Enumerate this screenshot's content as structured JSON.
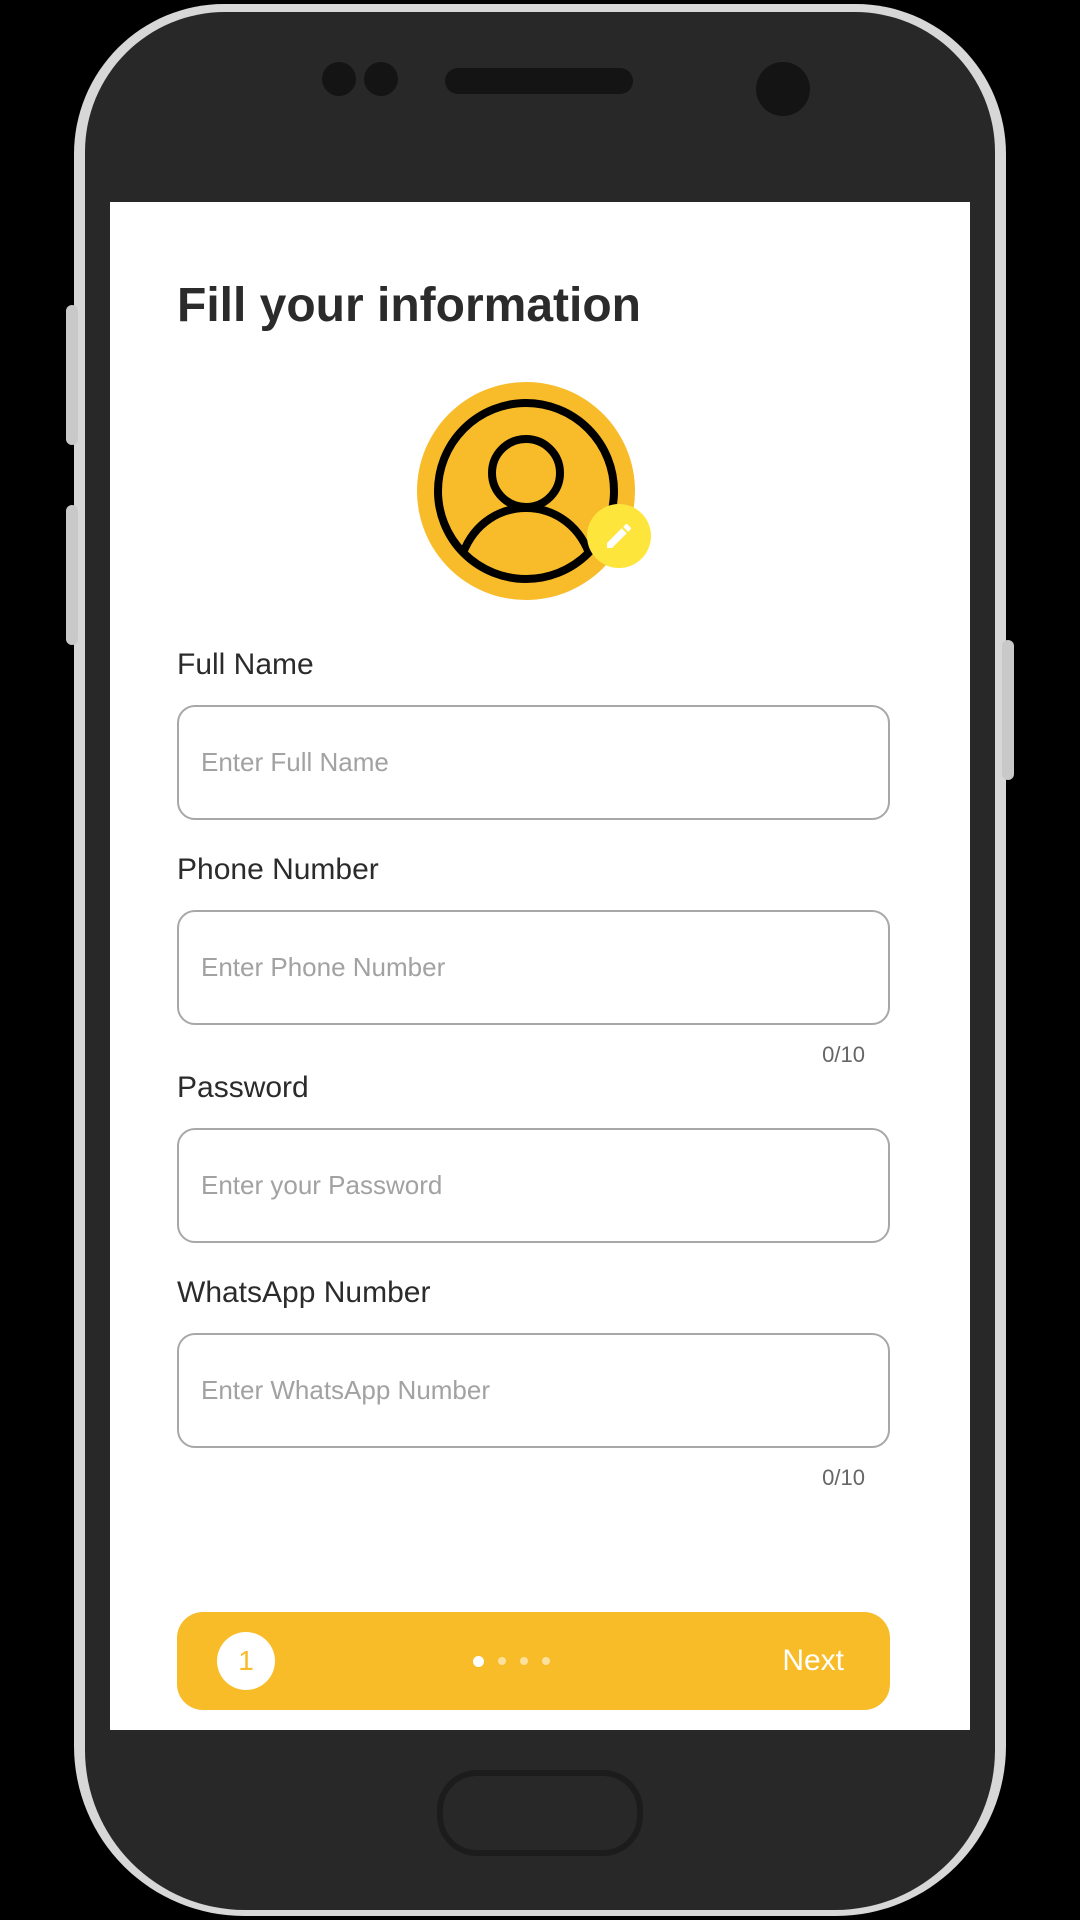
{
  "screen": {
    "title": "Fill your information"
  },
  "avatar": {
    "icon": "user-circle-icon",
    "edit_icon": "pencil-icon",
    "color": "#f8bc2b",
    "edit_color": "#fde53c"
  },
  "form": {
    "full_name": {
      "label": "Full Name",
      "placeholder": "Enter Full Name",
      "value": ""
    },
    "phone": {
      "label": "Phone Number",
      "placeholder": "Enter Phone Number",
      "value": "",
      "counter": "0/10"
    },
    "password": {
      "label": "Password",
      "placeholder": "Enter your Password",
      "value": ""
    },
    "whatsapp": {
      "label": "WhatsApp Number",
      "placeholder": "Enter WhatsApp Number",
      "value": "",
      "counter": "0/10"
    }
  },
  "footer": {
    "step": "1",
    "total_steps": 4,
    "current_step_index": 0,
    "next_label": "Next",
    "accent_color": "#f8bc28"
  }
}
